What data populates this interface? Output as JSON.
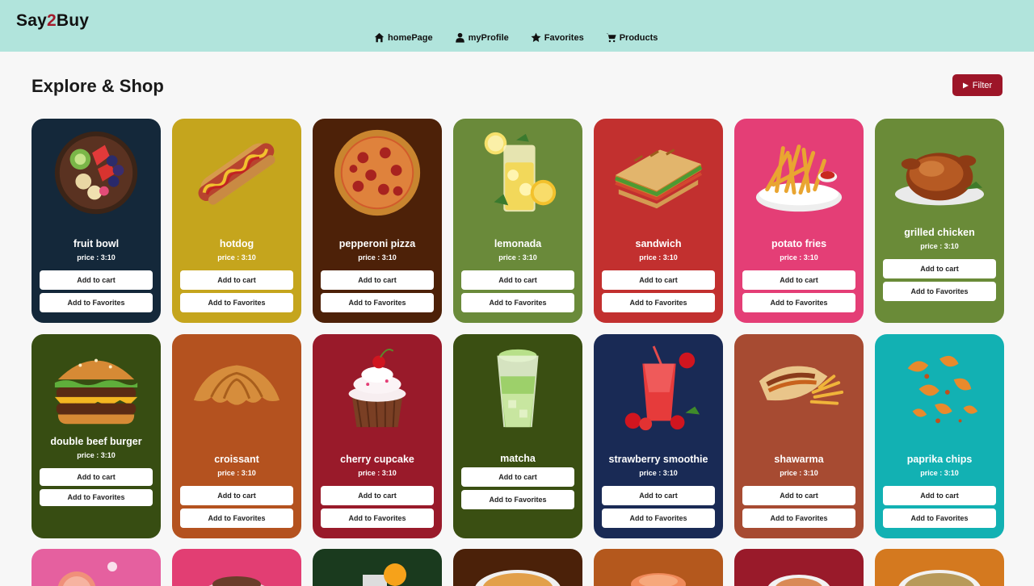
{
  "brand": {
    "part1": "Say",
    "part2": "2",
    "part3": "Buy"
  },
  "nav": [
    {
      "label": "homePage",
      "icon": "home-icon"
    },
    {
      "label": "myProfile",
      "icon": "user-icon"
    },
    {
      "label": "Favorites",
      "icon": "star-icon"
    },
    {
      "label": "Products",
      "icon": "cart-icon"
    }
  ],
  "page_title": "Explore & Shop",
  "filter": {
    "label": "Filter",
    "icon": "play-icon"
  },
  "buttons": {
    "add_cart": "Add to cart",
    "add_fav": "Add to Favorites"
  },
  "products": [
    {
      "name": "fruit bowl",
      "price": "price : 3:10",
      "color": "#14283a",
      "icon": "fruit-bowl-icon"
    },
    {
      "name": "hotdog",
      "price": "price : 3:10",
      "color": "#c5a51d",
      "icon": "hotdog-icon"
    },
    {
      "name": "pepperoni pizza",
      "price": "price : 3:10",
      "color": "#4d2108",
      "icon": "pizza-icon"
    },
    {
      "name": "lemonada",
      "price": "price : 3:10",
      "color": "#6a8a3a",
      "icon": "lemonade-icon"
    },
    {
      "name": "sandwich",
      "price": "price : 3:10",
      "color": "#c2302f",
      "icon": "sandwich-icon"
    },
    {
      "name": "potato fries",
      "price": "price : 3:10",
      "color": "#e43e76",
      "icon": "fries-icon"
    },
    {
      "name": "grilled chicken",
      "price": "price : 3:10",
      "color": "#6a8b38",
      "icon": "chicken-icon"
    },
    {
      "name": "double beef burger",
      "price": "price : 3:10",
      "color": "#374d12",
      "icon": "burger-icon"
    },
    {
      "name": "croissant",
      "price": "price : 3:10",
      "color": "#b4521f",
      "icon": "croissant-icon"
    },
    {
      "name": "cherry cupcake",
      "price": "price : 3:10",
      "color": "#991a2a",
      "icon": "cupcake-icon"
    },
    {
      "name": "matcha",
      "price": "",
      "color": "#3a4f12",
      "icon": "matcha-icon"
    },
    {
      "name": "strawberry smoothie",
      "price": "price : 3:10",
      "color": "#192a55",
      "icon": "smoothie-icon"
    },
    {
      "name": "shawarma",
      "price": "price : 3:10",
      "color": "#a74b32",
      "icon": "shawarma-icon"
    },
    {
      "name": "paprika chips",
      "price": "price : 3:10",
      "color": "#12b1b3",
      "icon": "chips-icon"
    }
  ],
  "peek_row": [
    {
      "color": "#e5609f",
      "icon": "grapefruit-icon"
    },
    {
      "color": "#e23e73",
      "icon": "dessert-icon"
    },
    {
      "color": "#1a3a1e",
      "icon": "drink-icon"
    },
    {
      "color": "#4b2109",
      "icon": "pasta-icon"
    },
    {
      "color": "#b4581d",
      "icon": "salmon-icon"
    },
    {
      "color": "#991a2a",
      "icon": "noodles-icon"
    },
    {
      "color": "#d4791f",
      "icon": "rice-icon"
    }
  ]
}
